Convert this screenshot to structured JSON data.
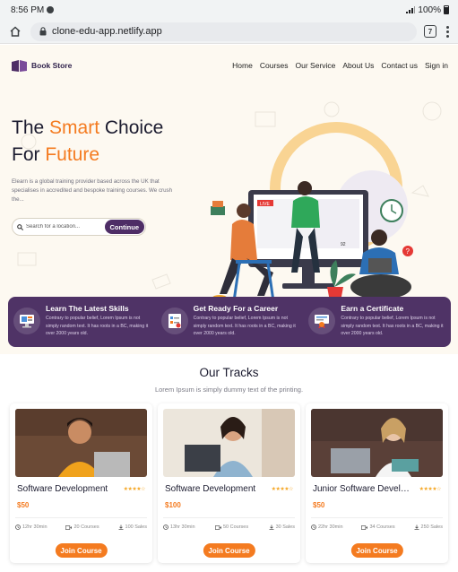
{
  "status_bar": {
    "time": "8:56 PM",
    "battery": "100%"
  },
  "browser": {
    "url": "clone-edu-app.netlify.app",
    "tab_count": "7"
  },
  "nav": {
    "brand": "Book Store",
    "links": [
      "Home",
      "Courses",
      "Our Service",
      "About Us",
      "Contact us",
      "Sign in"
    ]
  },
  "hero": {
    "title_line1_pre": "The ",
    "title_line1_accent": "Smart",
    "title_line1_post": " Choice",
    "title_line2_pre": "For ",
    "title_line2_accent": "Future",
    "description": "Elearn is a global training provider based across the UK that specialises in accredited and bespoke training courses. We crush the...",
    "search_placeholder": "Search for a location...",
    "continue_label": "Continue",
    "live_badge": "LIVE",
    "viewer_count": "92"
  },
  "features": [
    {
      "icon": "monitor-icon",
      "title": "Learn The Latest Skills",
      "text": "Contrary to popular belief, Lorem Ipsum is not simply random text. It has roots in a BC, making it over 2000 years old."
    },
    {
      "icon": "checklist-icon",
      "title": "Get Ready For a Career",
      "text": "Contrary to popular belief, Lorem Ipsum is not simply random text. It has roots in a BC, making it over 2000 years old."
    },
    {
      "icon": "certificate-icon",
      "title": "Earn a Certificate",
      "text": "Contrary to popular belief, Lorem Ipsum is not simply random text. It has roots in a BC, making it over 2000 years old."
    }
  ],
  "tracks": {
    "title": "Our Tracks",
    "subtitle": "Lorem Ipsum is simply dummy text of the printing.",
    "cards": [
      {
        "title": "Software Development",
        "stars": "★★★★☆",
        "price": "$50",
        "duration": "12hr 30min",
        "courses": "20 Courses",
        "sales": "100 Sales",
        "join_label": "Join Course"
      },
      {
        "title": "Software Development",
        "stars": "★★★★☆",
        "price": "$100",
        "duration": "13hr 30min",
        "courses": "50 Courses",
        "sales": "30 Sales",
        "join_label": "Join Course"
      },
      {
        "title": "Junior Software Developer",
        "stars": "★★★★☆",
        "price": "$50",
        "duration": "22hr 30min",
        "courses": "34 Courses",
        "sales": "250 Sales",
        "join_label": "Join Course"
      }
    ]
  },
  "colors": {
    "accent": "#f47b20",
    "brand_purple": "#4f3366",
    "hero_bg": "#fdf9f1"
  }
}
